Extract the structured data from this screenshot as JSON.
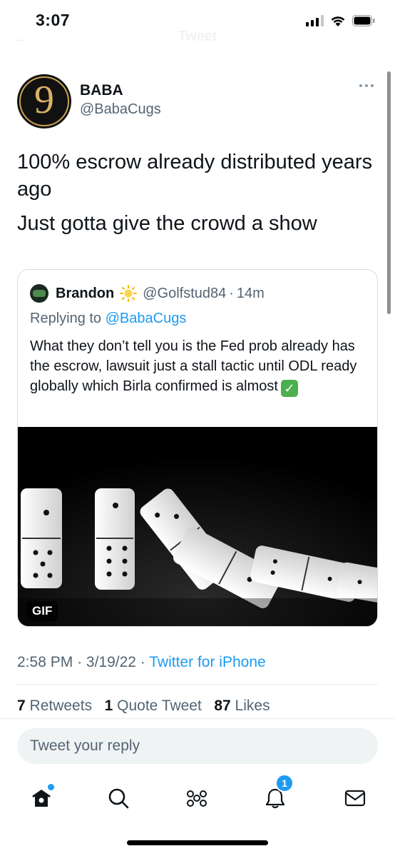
{
  "status_bar": {
    "time": "3:07"
  },
  "nav": {
    "title": "Tweet"
  },
  "tweet": {
    "author_name": "BABA",
    "author_handle": "@BabaCugs",
    "avatar_glyph": "9",
    "text_lines": [
      "100% escrow already distributed years ago",
      "Just gotta give the crowd a show"
    ],
    "time": "2:58 PM",
    "date": "3/19/22",
    "source": "Twitter for iPhone",
    "retweets_count": "7",
    "retweets_label": "Retweets",
    "quotes_count": "1",
    "quotes_label": "Quote Tweet",
    "likes_count": "87",
    "likes_label": "Likes"
  },
  "quote": {
    "author_name": "Brandon",
    "author_handle": "@Golfstud84",
    "age": "14m",
    "replying_prefix": "Replying to ",
    "replying_handle": "@BabaCugs",
    "text": "What they don’t tell you is the Fed prob already has the escrow, lawsuit just a stall tactic until ODL ready globally which Birla confirmed is almost",
    "media_badge": "GIF"
  },
  "reply": {
    "placeholder": "Tweet your reply"
  },
  "tabbar": {
    "notification_count": "1"
  },
  "colors": {
    "accent": "#1d9bf0",
    "secondary_text": "#536471",
    "primary_text": "#0f1419"
  }
}
